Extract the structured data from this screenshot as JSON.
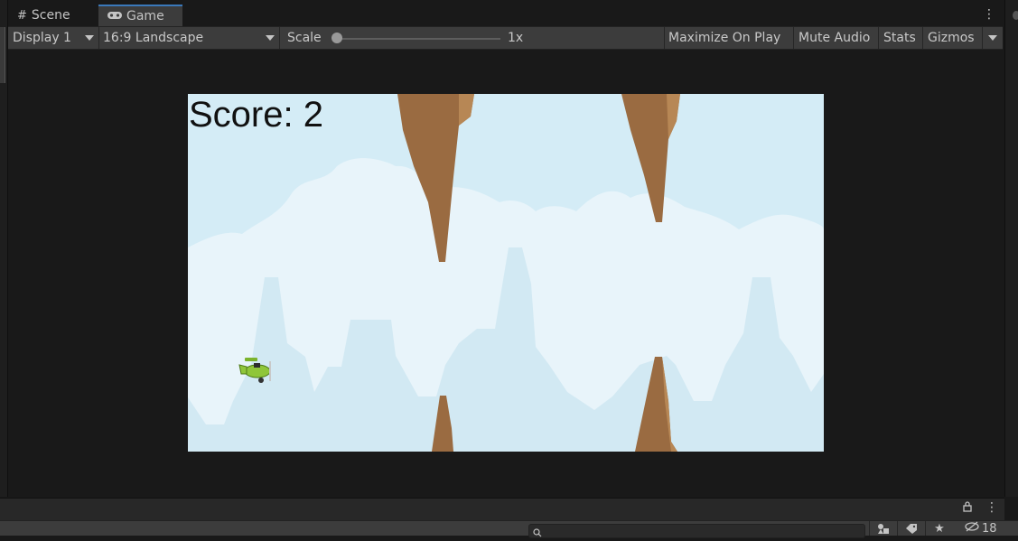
{
  "tabs": [
    {
      "label": "Scene",
      "icon": "grid-icon"
    },
    {
      "label": "Game",
      "icon": "gamepad-icon",
      "active": true
    }
  ],
  "toolbar": {
    "display": "Display 1",
    "aspect": "16:9 Landscape",
    "scale_label": "Scale",
    "scale_value": "1x",
    "scale_fraction": 0.0,
    "maximize_on_play": "Maximize On Play",
    "mute_audio": "Mute Audio",
    "stats": "Stats",
    "gizmos": "Gizmos"
  },
  "game": {
    "score_text": "Score: 2"
  },
  "bottom": {
    "hidden_count": "18"
  },
  "colors": {
    "sky": "#d4ecf6",
    "clouds": "#e8f4fa",
    "rock": "#9a6b41",
    "plane": "#8fc63a",
    "tab_accent": "#3a79bb"
  }
}
